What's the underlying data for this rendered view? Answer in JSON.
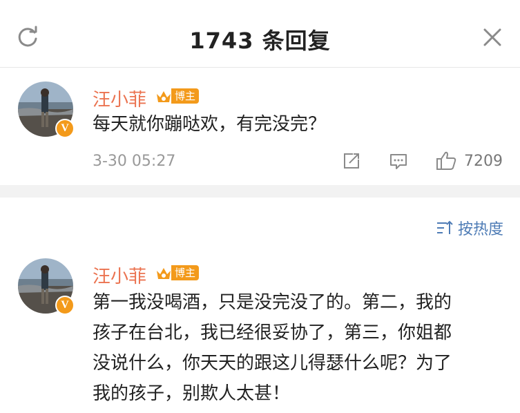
{
  "header": {
    "title": "1743 条回复",
    "refresh_icon": "refresh-icon",
    "close_icon": "close-icon"
  },
  "root_comment": {
    "author": "汪小菲",
    "badge": "博主",
    "verified_icon": "v-badge-icon",
    "text": "每天就你蹦哒欢，有完没完？",
    "time": "3-30 05:27",
    "likes": "7209",
    "share_icon": "share-icon",
    "comment_icon": "comment-icon",
    "like_icon": "thumbs-up-icon"
  },
  "sort": {
    "label": "按热度",
    "icon": "sort-icon"
  },
  "reply": {
    "author": "汪小菲",
    "badge": "博主",
    "lines": [
      "第一我没喝酒，只是没完没了的。第二，我的",
      "孩子在台北，我已经很妥协了，第三，你姐都",
      "没说什么，你天天的跟这儿得瑟什么呢？为了",
      "我的孩子，别欺人太甚！"
    ]
  },
  "colors": {
    "name": "#eb7350",
    "badge": "#f39a1b",
    "link": "#4d7bb5",
    "muted": "#999999"
  }
}
